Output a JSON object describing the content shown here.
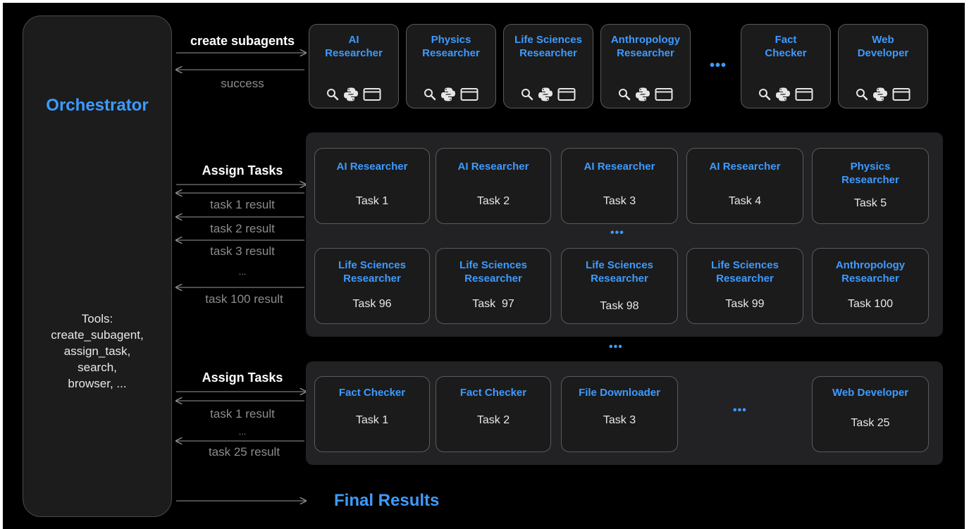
{
  "orchestrator": {
    "title": "Orchestrator",
    "tools_lines": [
      "Tools:",
      "create_subagent,",
      "assign_task,",
      "search,",
      "browser, ..."
    ]
  },
  "create_row": {
    "label": "create subagents",
    "return_label": "success",
    "agents": [
      {
        "line1": "AI",
        "line2": "Researcher"
      },
      {
        "line1": "Physics",
        "line2": "Researcher"
      },
      {
        "line1": "Life Sciences",
        "line2": "Researcher"
      },
      {
        "line1": "Anthropology",
        "line2": "Researcher"
      },
      {
        "line1": "Fact",
        "line2": "Checker"
      },
      {
        "line1": "Web",
        "line2": "Developer"
      }
    ],
    "ellipsis": "•••",
    "icon_names": [
      "search-icon",
      "python-icon",
      "browser-window-icon"
    ]
  },
  "group1": {
    "assign_label": "Assign Tasks",
    "results": [
      "task 1 result",
      "task 2 result",
      "task 3 result",
      "...",
      "task 100 result"
    ],
    "row1": [
      {
        "role_line1": "AI Researcher",
        "role_line2": "",
        "task": "Task 1"
      },
      {
        "role_line1": "AI Researcher",
        "role_line2": "",
        "task": "Task 2"
      },
      {
        "role_line1": "AI Researcher",
        "role_line2": "",
        "task": "Task 3"
      },
      {
        "role_line1": "AI Researcher",
        "role_line2": "",
        "task": "Task 4"
      },
      {
        "role_line1": "Physics",
        "role_line2": "Researcher",
        "task": "Task 5"
      }
    ],
    "middle_ellipsis": "•••",
    "row2": [
      {
        "role_line1": "Life Sciences",
        "role_line2": "Researcher",
        "task": "Task 96"
      },
      {
        "role_line1": "Life Sciences",
        "role_line2": "Researcher",
        "task": "Task  97"
      },
      {
        "role_line1": "Life Sciences",
        "role_line2": "Researcher",
        "task": "Task 98"
      },
      {
        "role_line1": "Life Sciences",
        "role_line2": "Researcher",
        "task": "Task 99"
      },
      {
        "role_line1": "Anthropology",
        "role_line2": "Researcher",
        "task": "Task 100"
      }
    ]
  },
  "between_ellipsis": "•••",
  "group2": {
    "assign_label": "Assign Tasks",
    "results": [
      "task 1 result",
      "...",
      "task 25 result"
    ],
    "cards": [
      {
        "role": "Fact Checker",
        "task": "Task 1"
      },
      {
        "role": "Fact Checker",
        "task": "Task 2"
      },
      {
        "role": "File Downloader",
        "task": "Task 3"
      },
      {
        "role": "Web Developer",
        "task": "Task 25"
      }
    ],
    "ellipsis": "•••"
  },
  "final_label": "Final Results",
  "colors": {
    "accent": "#3d9bff",
    "background": "#000000",
    "card_border": "#5a5a5c",
    "muted_text": "#8c8c8c"
  }
}
